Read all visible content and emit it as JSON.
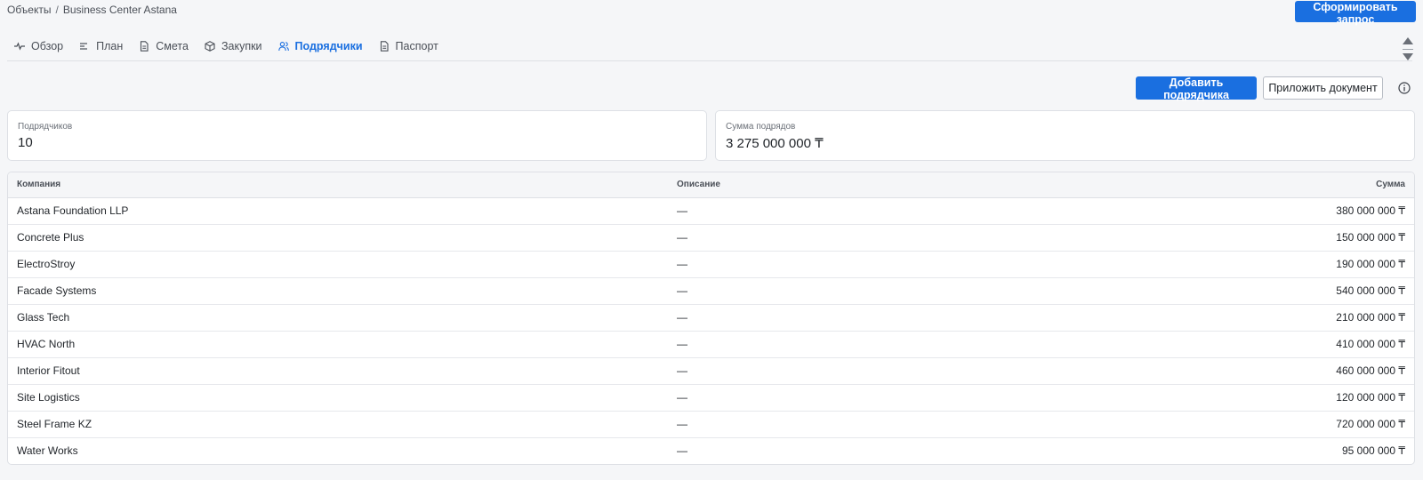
{
  "breadcrumb": {
    "parent": "Объекты",
    "separator": "/",
    "current": "Business Center Astana"
  },
  "header": {
    "generate_button": "Сформировать запрос"
  },
  "tabs": [
    {
      "label": "Обзор",
      "icon": "activity-icon"
    },
    {
      "label": "План",
      "icon": "list-icon"
    },
    {
      "label": "Смета",
      "icon": "document-icon"
    },
    {
      "label": "Закупки",
      "icon": "box-icon"
    },
    {
      "label": "Подрядчики",
      "icon": "users-icon",
      "active": true
    },
    {
      "label": "Паспорт",
      "icon": "document-icon"
    }
  ],
  "actions": {
    "add_button": "Добавить подрядчика",
    "attach_button": "Приложить документ",
    "info_icon": "info-icon"
  },
  "stats": {
    "contractors_label": "Подрядчиков",
    "contractors_value": "10",
    "sum_label": "Сумма подрядов",
    "sum_value": "3 275 000 000 ₸"
  },
  "table": {
    "columns": [
      "Компания",
      "Описание",
      "Сумма"
    ],
    "rows": [
      {
        "company": "Astana Foundation LLP",
        "description": "—",
        "sum": "380 000 000 ₸"
      },
      {
        "company": "Concrete Plus",
        "description": "—",
        "sum": "150 000 000 ₸"
      },
      {
        "company": "ElectroStroy",
        "description": "—",
        "sum": "190 000 000 ₸"
      },
      {
        "company": "Facade Systems",
        "description": "—",
        "sum": "540 000 000 ₸"
      },
      {
        "company": "Glass Tech",
        "description": "—",
        "sum": "210 000 000 ₸"
      },
      {
        "company": "HVAC North",
        "description": "—",
        "sum": "410 000 000 ₸"
      },
      {
        "company": "Interior Fitout",
        "description": "—",
        "sum": "460 000 000 ₸"
      },
      {
        "company": "Site Logistics",
        "description": "—",
        "sum": "120 000 000 ₸"
      },
      {
        "company": "Steel Frame KZ",
        "description": "—",
        "sum": "720 000 000 ₸"
      },
      {
        "company": "Water Works",
        "description": "—",
        "sum": "95 000 000 ₸"
      }
    ]
  },
  "colors": {
    "accent": "#1a6fe0",
    "background": "#f5f6f8",
    "border": "#dde0e5"
  }
}
